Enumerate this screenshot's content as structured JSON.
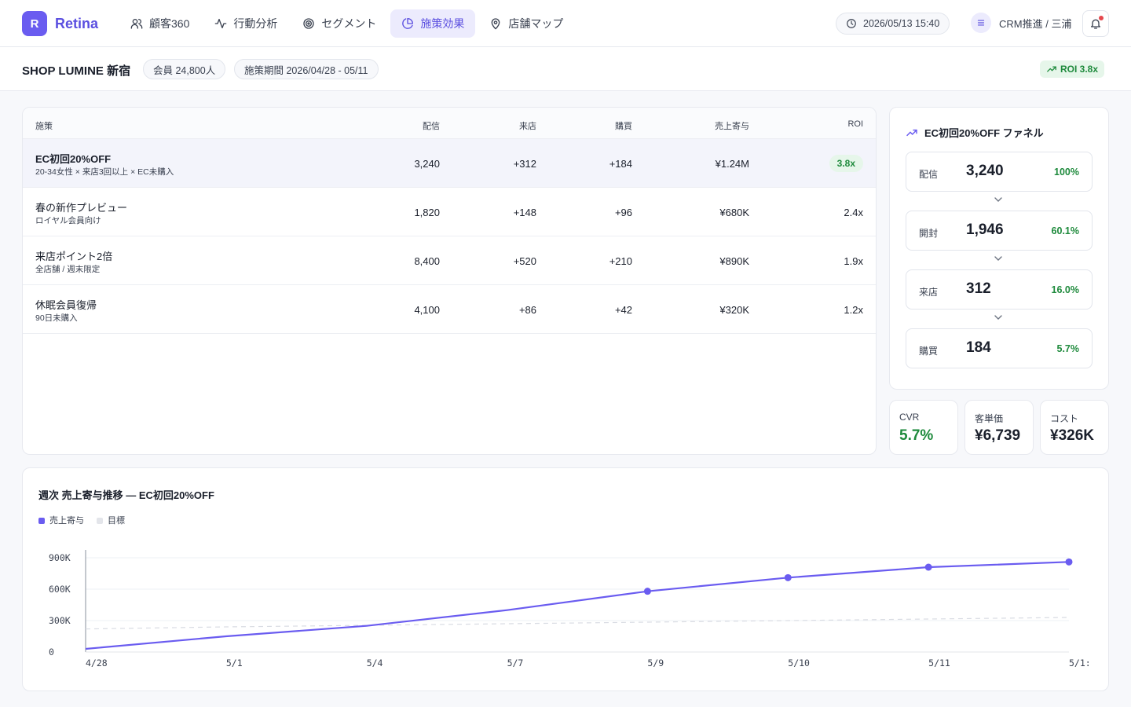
{
  "app": {
    "logo_letter": "R",
    "name": "Retina"
  },
  "nav": [
    {
      "label": "顧客360",
      "icon": "users-icon",
      "active": false
    },
    {
      "label": "行動分析",
      "icon": "activity-icon",
      "active": false
    },
    {
      "label": "セグメント",
      "icon": "target-icon",
      "active": false
    },
    {
      "label": "施策効果",
      "icon": "pie-chart-icon",
      "active": true
    },
    {
      "label": "店舗マップ",
      "icon": "map-pin-icon",
      "active": false
    }
  ],
  "header": {
    "datetime": "2026/05/13 15:40",
    "user": "CRM推進 / 三浦"
  },
  "subheader": {
    "shop": "SHOP LUMINE 新宿",
    "members": "会員 24,800人",
    "period": "施策期間 2026/04/28 - 05/11",
    "roi": "ROI 3.8x"
  },
  "table": {
    "headers": {
      "name": "施策",
      "sent": "配信",
      "visit": "来店",
      "purchase": "購買",
      "sales": "売上寄与",
      "roi": "ROI"
    },
    "rows": [
      {
        "name": "EC初回20%OFF",
        "sub": "20-34女性 × 来店3回以上 × EC未購入",
        "sent": "3,240",
        "visit": "+312",
        "purchase": "+184",
        "sales": "¥1.24M",
        "roi": "3.8x",
        "selected": true
      },
      {
        "name": "春の新作プレビュー",
        "sub": "ロイヤル会員向け",
        "sent": "1,820",
        "visit": "+148",
        "purchase": "+96",
        "sales": "¥680K",
        "roi": "2.4x",
        "selected": false
      },
      {
        "name": "来店ポイント2倍",
        "sub": "全店舗 / 週末限定",
        "sent": "8,400",
        "visit": "+520",
        "purchase": "+210",
        "sales": "¥890K",
        "roi": "1.9x",
        "selected": false
      },
      {
        "name": "休眠会員復帰",
        "sub": "90日未購入",
        "sent": "4,100",
        "visit": "+86",
        "purchase": "+42",
        "sales": "¥320K",
        "roi": "1.2x",
        "selected": false
      }
    ]
  },
  "funnel": {
    "title": "EC初回20%OFF ファネル",
    "steps": [
      {
        "label": "配信",
        "value": "3,240",
        "pct": "100%"
      },
      {
        "label": "開封",
        "value": "1,946",
        "pct": "60.1%"
      },
      {
        "label": "来店",
        "value": "312",
        "pct": "16.0%"
      },
      {
        "label": "購買",
        "value": "184",
        "pct": "5.7%"
      }
    ]
  },
  "kpis": [
    {
      "label": "CVR",
      "value": "5.7%",
      "green": true
    },
    {
      "label": "客単価",
      "value": "¥6,739",
      "green": false
    },
    {
      "label": "コスト",
      "value": "¥326K",
      "green": false
    }
  ],
  "colors": {
    "accent": "#6a5cf0",
    "positive": "#1e8a3c",
    "target": "#d9dce3"
  },
  "chart_data": {
    "type": "line",
    "title": "週次 売上寄与推移 — EC初回20%OFF",
    "categories": [
      "4/28",
      "5/1",
      "5/4",
      "5/7",
      "5/9",
      "5/10",
      "5/11",
      "5/1:"
    ],
    "series": [
      {
        "name": "売上寄与",
        "values": [
          30000,
          150000,
          250000,
          400000,
          580000,
          710000,
          810000,
          860000
        ],
        "markers": [
          false,
          false,
          false,
          false,
          true,
          true,
          true,
          true
        ]
      },
      {
        "name": "目標",
        "values": [
          220000,
          240000,
          255000,
          270000,
          285000,
          300000,
          315000,
          330000
        ]
      }
    ],
    "yticks": [
      "900K",
      "600K",
      "300K",
      "0"
    ],
    "ytick_values": [
      900000,
      600000,
      300000,
      0
    ],
    "ylim": [
      0,
      900000
    ],
    "grid": true,
    "legend": "top-left"
  }
}
